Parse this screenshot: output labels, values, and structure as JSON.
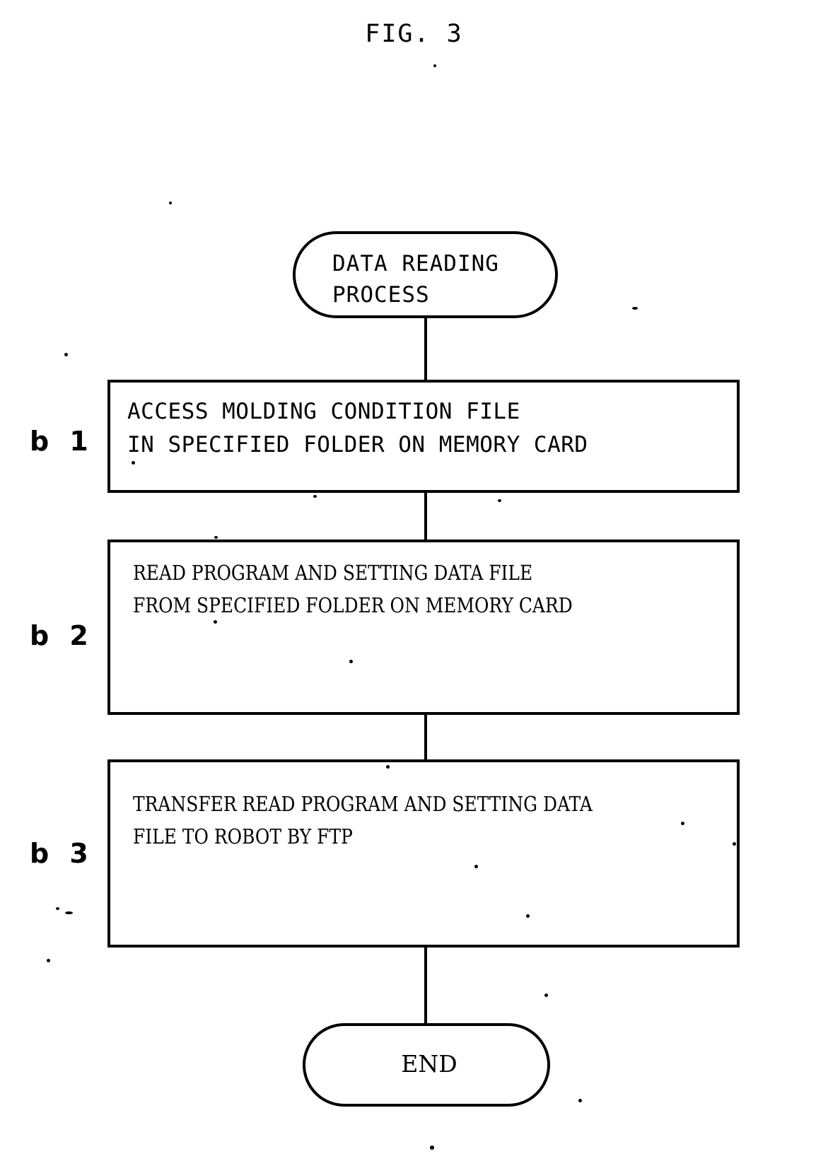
{
  "figure": {
    "title": "FIG. 3",
    "type": "flowchart",
    "description": "Data reading process flowchart"
  },
  "nodes": {
    "start": {
      "shape": "terminator",
      "text": "DATA READING\nPROCESS"
    },
    "b1": {
      "shape": "process",
      "ref": "b 1",
      "text": "ACCESS MOLDING CONDITION FILE\nIN SPECIFIED FOLDER ON MEMORY CARD"
    },
    "b2": {
      "shape": "process",
      "ref": "b 2",
      "text": "READ PROGRAM AND SETTING DATA FILE\nFROM SPECIFIED FOLDER ON MEMORY CARD"
    },
    "b3": {
      "shape": "process",
      "ref": "b 3",
      "text": "TRANSFER READ PROGRAM AND SETTING DATA\nFILE TO ROBOT BY FTP"
    },
    "end": {
      "shape": "terminator",
      "text": "END"
    }
  },
  "colors": {
    "ink": "#000000",
    "paper": "#ffffff"
  }
}
